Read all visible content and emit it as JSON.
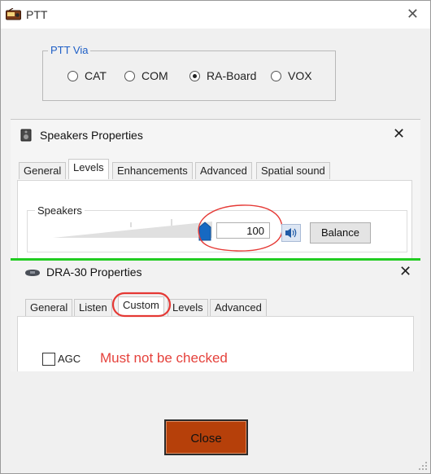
{
  "window": {
    "title": "PTT",
    "close_glyph": "✕"
  },
  "ptt_via": {
    "legend": "PTT Via",
    "options": [
      {
        "label": "CAT",
        "selected": false
      },
      {
        "label": "COM",
        "selected": false
      },
      {
        "label": "RA-Board",
        "selected": true
      },
      {
        "label": "VOX",
        "selected": false
      }
    ]
  },
  "speakers_dialog": {
    "title": "Speakers Properties",
    "tabs": [
      "General",
      "Levels",
      "Enhancements",
      "Advanced",
      "Spatial sound"
    ],
    "active_tab": "Levels",
    "group_label": "Speakers",
    "volume": "100",
    "volume_fraction": 1.0,
    "balance_label": "Balance",
    "close_glyph": "✕"
  },
  "dra30_dialog": {
    "title": "DRA-30 Properties",
    "tabs": [
      "General",
      "Listen",
      "Custom",
      "Levels",
      "Advanced"
    ],
    "active_tab": "Custom",
    "agc_label": "AGC",
    "agc_checked": false,
    "note": "Must not be checked",
    "close_glyph": "✕"
  },
  "close_button": {
    "label": "Close"
  },
  "colors": {
    "annotation": "#e53935",
    "separator": "#22cc22",
    "close_button": "#b6400a",
    "link_blue": "#1e5fc6"
  },
  "icons": [
    "radio-app-icon",
    "speaker-device-icon",
    "speaker-volume-icon",
    "sound-card-icon",
    "resize-grip-icon"
  ]
}
